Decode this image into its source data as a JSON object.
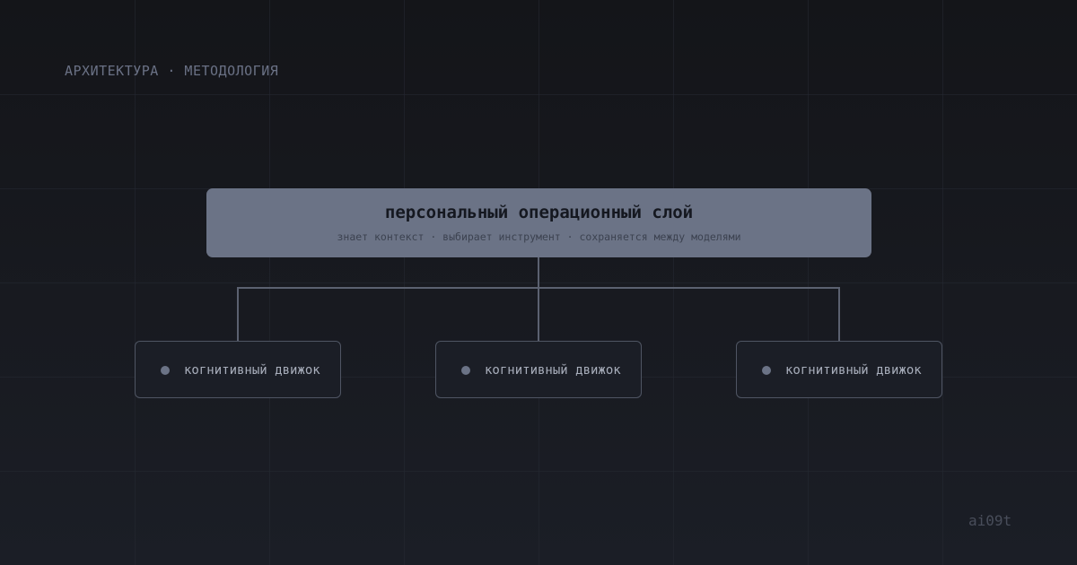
{
  "header": {
    "eyebrow": "АРХИТЕКТУРА · МЕТОДОЛОГИЯ"
  },
  "diagram": {
    "type": "tree",
    "root": {
      "title": "персональный операционный слой",
      "subtitle": "знает контекст · выбирает инструмент · сохраняется между моделями"
    },
    "children": [
      {
        "label": "когнитивный движок"
      },
      {
        "label": "когнитивный движок"
      },
      {
        "label": "когнитивный движок"
      }
    ]
  },
  "footer": {
    "watermark": "ai09t"
  },
  "colors": {
    "background": "#15171c",
    "root_fill": "#6b7386",
    "connector": "#5b6170",
    "engine_border": "#4f5563",
    "engine_text": "#a8aebb",
    "muted_text": "#6a7185"
  }
}
